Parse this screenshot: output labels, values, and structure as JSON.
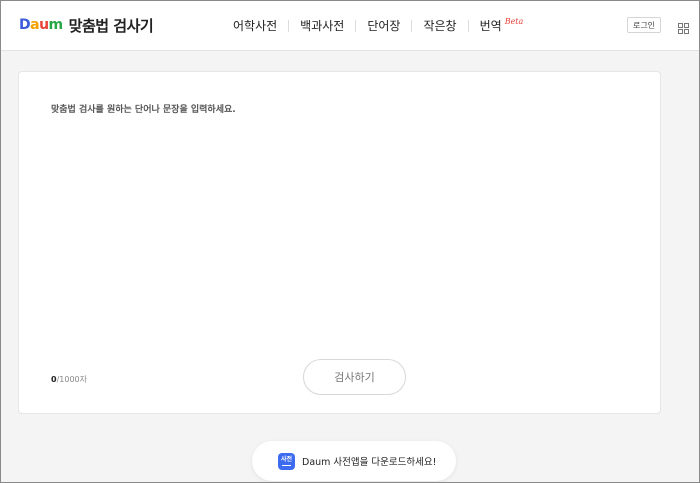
{
  "header": {
    "logo_parts": [
      "D",
      "a",
      "u",
      "m"
    ],
    "service_title": "맞춤법 검사기",
    "nav": [
      {
        "label": "어학사전"
      },
      {
        "label": "백과사전"
      },
      {
        "label": "단어장"
      },
      {
        "label": "작은창"
      },
      {
        "label": "번역",
        "badge": "Beta"
      }
    ],
    "login_label": "로그인",
    "apps_icon": "grid-icon"
  },
  "editor": {
    "placeholder": "맞춤법 검사를 원하는 단어나 문장을 입력하세요.",
    "value": "",
    "count_current": "0",
    "count_max": "/1000자",
    "submit_label": "검사하기"
  },
  "app_banner": {
    "icon_text": "사전",
    "text": "Daum 사전앱을 다운로드하세요!"
  },
  "colors": {
    "accent": "#3d6bf0",
    "beta": "#e8413a",
    "background": "#f4f4f5"
  }
}
